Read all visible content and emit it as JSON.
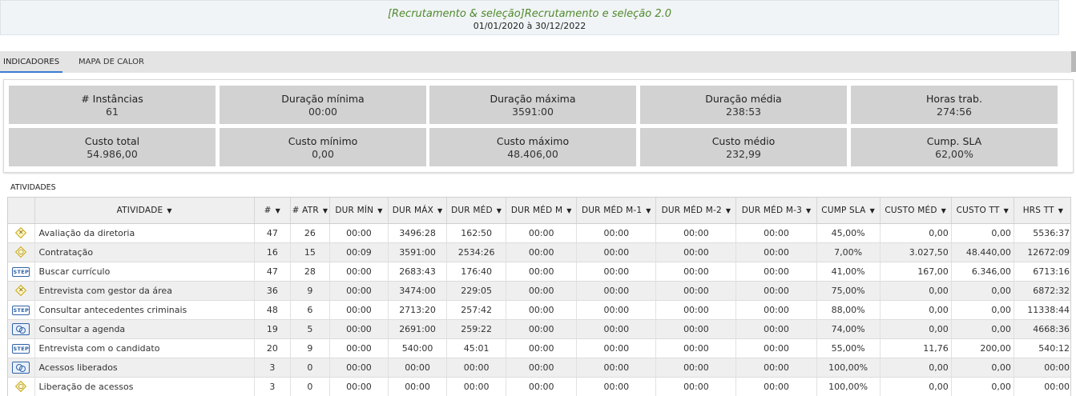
{
  "header": {
    "title": "[Recrutamento & seleção]Recrutamento e seleção 2.0",
    "dates": "01/01/2020 à 30/12/2022"
  },
  "tabs": [
    {
      "label": "INDICADORES",
      "active": true
    },
    {
      "label": "MAPA DE CALOR",
      "active": false
    }
  ],
  "kpis": [
    {
      "label": "# Instâncias",
      "value": "61"
    },
    {
      "label": "Duração mínima",
      "value": "00:00"
    },
    {
      "label": "Duração máxima",
      "value": "3591:00"
    },
    {
      "label": "Duração média",
      "value": "238:53"
    },
    {
      "label": "Horas trab.",
      "value": "274:56"
    },
    {
      "label": "Custo total",
      "value": "54.986,00"
    },
    {
      "label": "Custo mínimo",
      "value": "0,00"
    },
    {
      "label": "Custo máximo",
      "value": "48.406,00"
    },
    {
      "label": "Custo médio",
      "value": "232,99"
    },
    {
      "label": "Cump. SLA",
      "value": "62,00%"
    }
  ],
  "activities": {
    "section_title": "ATIVIDADES",
    "sort_glyph": "▼",
    "columns": [
      "ATIVIDADE",
      "#",
      "# ATR",
      "DUR MÍN",
      "DUR MÁX",
      "DUR MÉD",
      "DUR MÉD M",
      "DUR MÉD M-1",
      "DUR MÉD M-2",
      "DUR MÉD M-3",
      "CUMP SLA",
      "CUSTO MÉD",
      "CUSTO TT",
      "HRS TT"
    ],
    "rows": [
      {
        "icon": "decision-x-icon",
        "name": "Avaliação da diretoria",
        "count": "47",
        "atr": "26",
        "dur_min": "00:00",
        "dur_max": "3496:28",
        "dur_med": "162:50",
        "m": "00:00",
        "m1": "00:00",
        "m2": "00:00",
        "m3": "00:00",
        "sla": "45,00%",
        "custo_med": "0,00",
        "custo_tt": "0,00",
        "hrs_tt": "5536:37"
      },
      {
        "icon": "decision-circle-icon",
        "name": "Contratação",
        "count": "16",
        "atr": "15",
        "dur_min": "00:09",
        "dur_max": "3591:00",
        "dur_med": "2534:26",
        "m": "00:00",
        "m1": "00:00",
        "m2": "00:00",
        "m3": "00:00",
        "sla": "7,00%",
        "custo_med": "3.027,50",
        "custo_tt": "48.440,00",
        "hrs_tt": "12672:09"
      },
      {
        "icon": "step-icon",
        "name": "Buscar currículo",
        "count": "47",
        "atr": "28",
        "dur_min": "00:00",
        "dur_max": "2683:43",
        "dur_med": "176:40",
        "m": "00:00",
        "m1": "00:00",
        "m2": "00:00",
        "m3": "00:00",
        "sla": "41,00%",
        "custo_med": "167,00",
        "custo_tt": "6.346,00",
        "hrs_tt": "6713:16"
      },
      {
        "icon": "decision-x-icon",
        "name": "Entrevista com gestor da área",
        "count": "36",
        "atr": "9",
        "dur_min": "00:00",
        "dur_max": "3474:00",
        "dur_med": "229:05",
        "m": "00:00",
        "m1": "00:00",
        "m2": "00:00",
        "m3": "00:00",
        "sla": "75,00%",
        "custo_med": "0,00",
        "custo_tt": "0,00",
        "hrs_tt": "6872:32"
      },
      {
        "icon": "step-icon",
        "name": "Consultar antecedentes criminais",
        "count": "48",
        "atr": "6",
        "dur_min": "00:00",
        "dur_max": "2713:20",
        "dur_med": "257:42",
        "m": "00:00",
        "m1": "00:00",
        "m2": "00:00",
        "m3": "00:00",
        "sla": "88,00%",
        "custo_med": "0,00",
        "custo_tt": "0,00",
        "hrs_tt": "11338:44"
      },
      {
        "icon": "subprocess-icon",
        "name": "Consultar a agenda",
        "count": "19",
        "atr": "5",
        "dur_min": "00:00",
        "dur_max": "2691:00",
        "dur_med": "259:22",
        "m": "00:00",
        "m1": "00:00",
        "m2": "00:00",
        "m3": "00:00",
        "sla": "74,00%",
        "custo_med": "0,00",
        "custo_tt": "0,00",
        "hrs_tt": "4668:36"
      },
      {
        "icon": "step-icon",
        "name": "Entrevista com o candidato",
        "count": "20",
        "atr": "9",
        "dur_min": "00:00",
        "dur_max": "540:00",
        "dur_med": "45:01",
        "m": "00:00",
        "m1": "00:00",
        "m2": "00:00",
        "m3": "00:00",
        "sla": "55,00%",
        "custo_med": "11,76",
        "custo_tt": "200,00",
        "hrs_tt": "540:12"
      },
      {
        "icon": "subprocess-icon",
        "name": "Acessos liberados",
        "count": "3",
        "atr": "0",
        "dur_min": "00:00",
        "dur_max": "00:00",
        "dur_med": "00:00",
        "m": "00:00",
        "m1": "00:00",
        "m2": "00:00",
        "m3": "00:00",
        "sla": "100,00%",
        "custo_med": "0,00",
        "custo_tt": "0,00",
        "hrs_tt": "00:00"
      },
      {
        "icon": "decision-circle-icon",
        "name": "Liberação de acessos",
        "count": "3",
        "atr": "0",
        "dur_min": "00:00",
        "dur_max": "00:00",
        "dur_med": "00:00",
        "m": "00:00",
        "m1": "00:00",
        "m2": "00:00",
        "m3": "00:00",
        "sla": "100,00%",
        "custo_med": "0,00",
        "custo_tt": "0,00",
        "hrs_tt": "00:00"
      }
    ],
    "step_label": "STEP"
  }
}
